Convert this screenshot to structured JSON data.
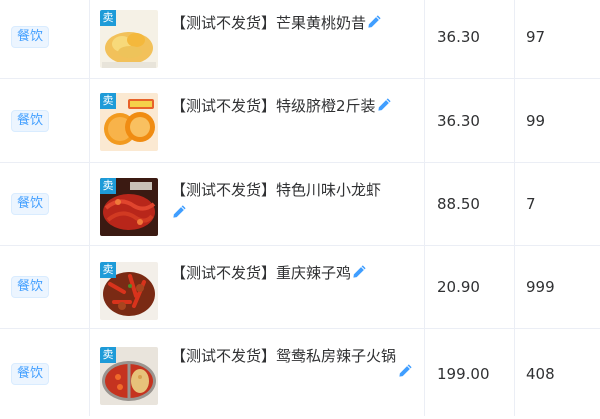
{
  "rows": [
    {
      "category": "餐饮",
      "name": "【测试不发货】芒果黄桃奶昔",
      "price": "36.30",
      "stock": "97",
      "image_badge": "卖"
    },
    {
      "category": "餐饮",
      "name": "【测试不发货】特级脐橙2斤装",
      "price": "36.30",
      "stock": "99",
      "image_badge": "卖"
    },
    {
      "category": "餐饮",
      "name": "【测试不发货】特色川味小龙虾",
      "price": "88.50",
      "stock": "7",
      "image_badge": "卖"
    },
    {
      "category": "餐饮",
      "name": "【测试不发货】重庆辣子鸡",
      "price": "20.90",
      "stock": "999",
      "image_badge": "卖"
    },
    {
      "category": "餐饮",
      "name": "【测试不发货】鸳鸯私房辣子火锅",
      "price": "199.00",
      "stock": "408",
      "image_badge": "卖"
    }
  ],
  "colors": {
    "tag_text": "#409eff",
    "tag_bg": "#ecf5ff",
    "edit_icon": "#409eff",
    "border": "#ebeef5"
  },
  "icons": {
    "edit": "pencil-icon"
  }
}
